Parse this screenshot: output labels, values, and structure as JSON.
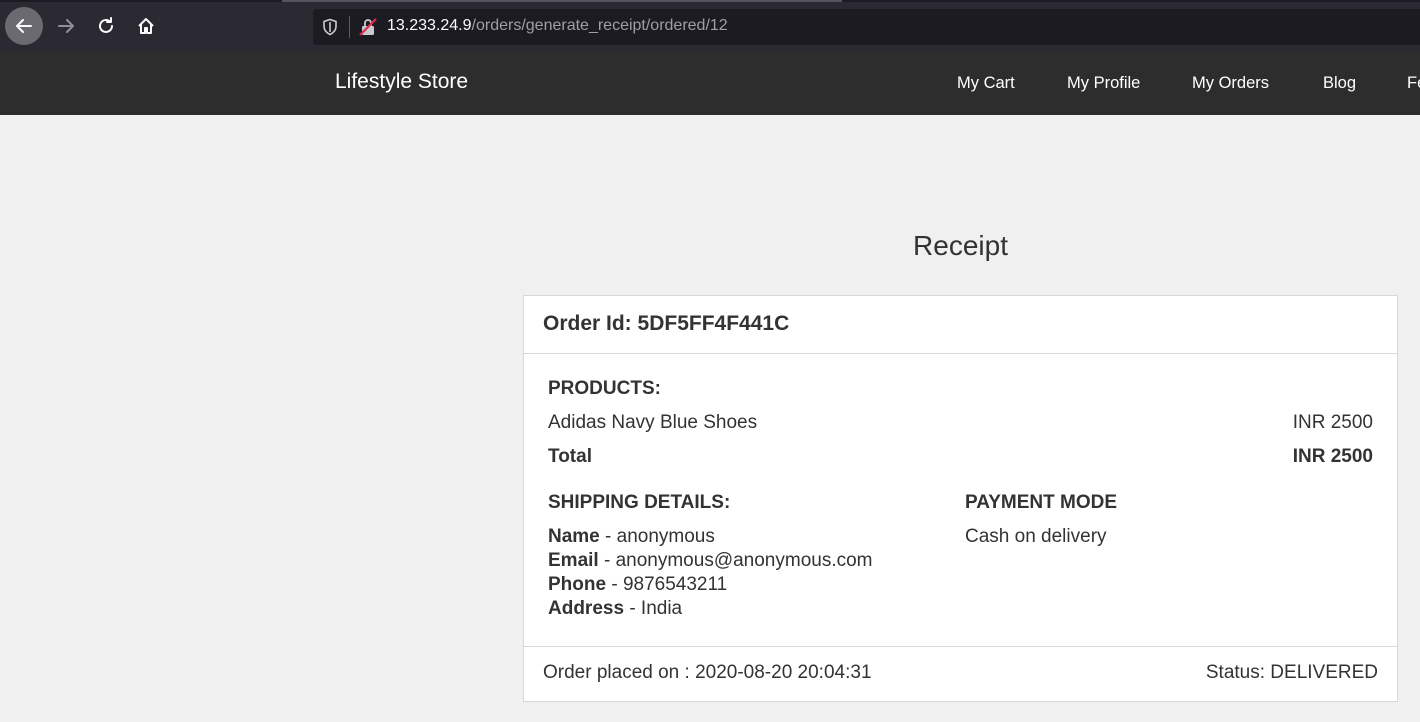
{
  "browser": {
    "url_host": "13.233.24.9",
    "url_path": "/orders/generate_receipt/ordered/12"
  },
  "navbar": {
    "brand": "Lifestyle Store",
    "links": [
      "My Cart",
      "My Profile",
      "My Orders",
      "Blog",
      "Fe"
    ]
  },
  "receipt": {
    "heading": "Receipt",
    "order_id_label": "Order Id:",
    "order_id": "5DF5FF4F441C",
    "products_label": "PRODUCTS:",
    "products": [
      {
        "name": "Adidas Navy Blue Shoes",
        "price": "INR 2500"
      }
    ],
    "total_label": "Total",
    "total_value": "INR 2500",
    "shipping_label": "SHIPPING DETAILS:",
    "shipping": {
      "name_label": "Name",
      "name": "- anonymous",
      "email_label": "Email",
      "email": "- anonymous@anonymous.com",
      "phone_label": "Phone",
      "phone": "- 9876543211",
      "address_label": "Address",
      "address": "- India"
    },
    "payment_label": "PAYMENT MODE",
    "payment_mode": "Cash on delivery",
    "placed_on": "Order placed on : 2020-08-20 20:04:31",
    "status": "Status: DELIVERED"
  }
}
